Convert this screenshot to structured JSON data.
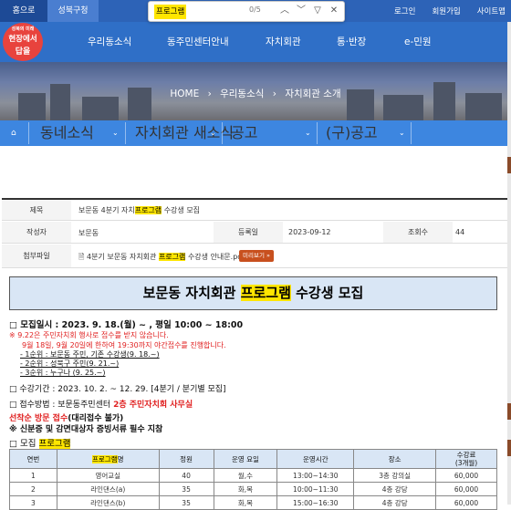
{
  "topbar": {
    "home": "홈으로",
    "gu": "성북구청",
    "login": "로그인",
    "join": "회원가입",
    "sitemap": "사이트맵"
  },
  "findbar": {
    "query": "프로그램",
    "count": "0/5"
  },
  "logo": {
    "line1": "성북의 미래",
    "line2": "현장에서",
    "line3": "답을"
  },
  "nav": {
    "items": [
      "우리동소식",
      "동주민센터안내",
      "자치회관",
      "통·반장",
      "e-민원"
    ]
  },
  "breadcrumb": {
    "home": "HOME",
    "sep": "›",
    "level1": "우리동소식",
    "level2": "자치회관 소개"
  },
  "subnav": {
    "items": [
      "동네소식",
      "자치회관 새소식",
      "공고",
      "(구)공고"
    ]
  },
  "post": {
    "title_label": "제목",
    "title_pre": "보문동 4분기 자치",
    "title_hl": "프로그램",
    "title_post": " 수강생 모집",
    "author_label": "작성자",
    "author": "보문동",
    "date_label": "등록일",
    "date": "2023-09-12",
    "views_label": "조회수",
    "views": "44",
    "file_label": "첨부파일",
    "file_pre": "보문동 자치회관 ",
    "file_hl": "프로그램",
    "file_post": " 수강생 안내문.pdf",
    "file_btn": "미리보기",
    "file_arrow": "»",
    "file_number": "4분기"
  },
  "notice": {
    "title_pre": "보문동 자치회관 ",
    "title_hl": "프로그램",
    "title_post": " 수강생 모집",
    "line1": "□ 모집일시 : 2023. 9. 18.(월) ~ , 평일 10:00 ~ 18:00",
    "line2": "※ 9.22은 주민자치회 행사로 접수를 받지 않습니다.",
    "line3": "9월 18일, 9월 20일에 한하여 19:30까지 야간접수를 진행합니다.",
    "line4": "- 1순위 : 보문동 주민, 기존 수강생(9. 18.~)",
    "line5": "- 2순위 : 성북구 주민(9. 21.~)",
    "line6": "- 3순위 : 누구나 (9. 25.~)",
    "line7": "□ 수강기간 : 2023. 10. 2. ~ 12. 29. [4분기 / 분기별 모집]",
    "line8_pre": "□ 접수방법 : 보문동주민센터 ",
    "line8_red": "2층 주민자치회 사무실",
    "line9_red": "선착순 방문 접수",
    "line9_post": "(대리접수 불가)",
    "line10": "※ 신분증 및 감면대상자 증빙서류 필수 지참",
    "line11_pre": "□ 모집 ",
    "line11_hl": "프로그램"
  },
  "table": {
    "headers": [
      "연번",
      "프로그램명",
      "정원",
      "운영 요일",
      "운영시간",
      "장소",
      "수강료 (3개월)"
    ],
    "header_hl": "프로그램",
    "header_post": "명",
    "fee_line1": "수강료",
    "fee_line2": "(3개월)",
    "rows": [
      [
        "1",
        "영어교실",
        "40",
        "월,수",
        "13:00~14:30",
        "3층 강의실",
        "60,000"
      ],
      [
        "2",
        "라인댄스(a)",
        "35",
        "화,목",
        "10:00~11:30",
        "4층 강당",
        "60,000"
      ],
      [
        "3",
        "라인댄스(b)",
        "35",
        "화,목",
        "15:00~16:30",
        "4층 강당",
        "60,000"
      ]
    ]
  },
  "colors": {
    "topbar": "#2d63b7",
    "header": "#2f6fc7",
    "subnav": "#3d86e0",
    "highlight": "#ffe600",
    "red_text": "#e02020"
  }
}
